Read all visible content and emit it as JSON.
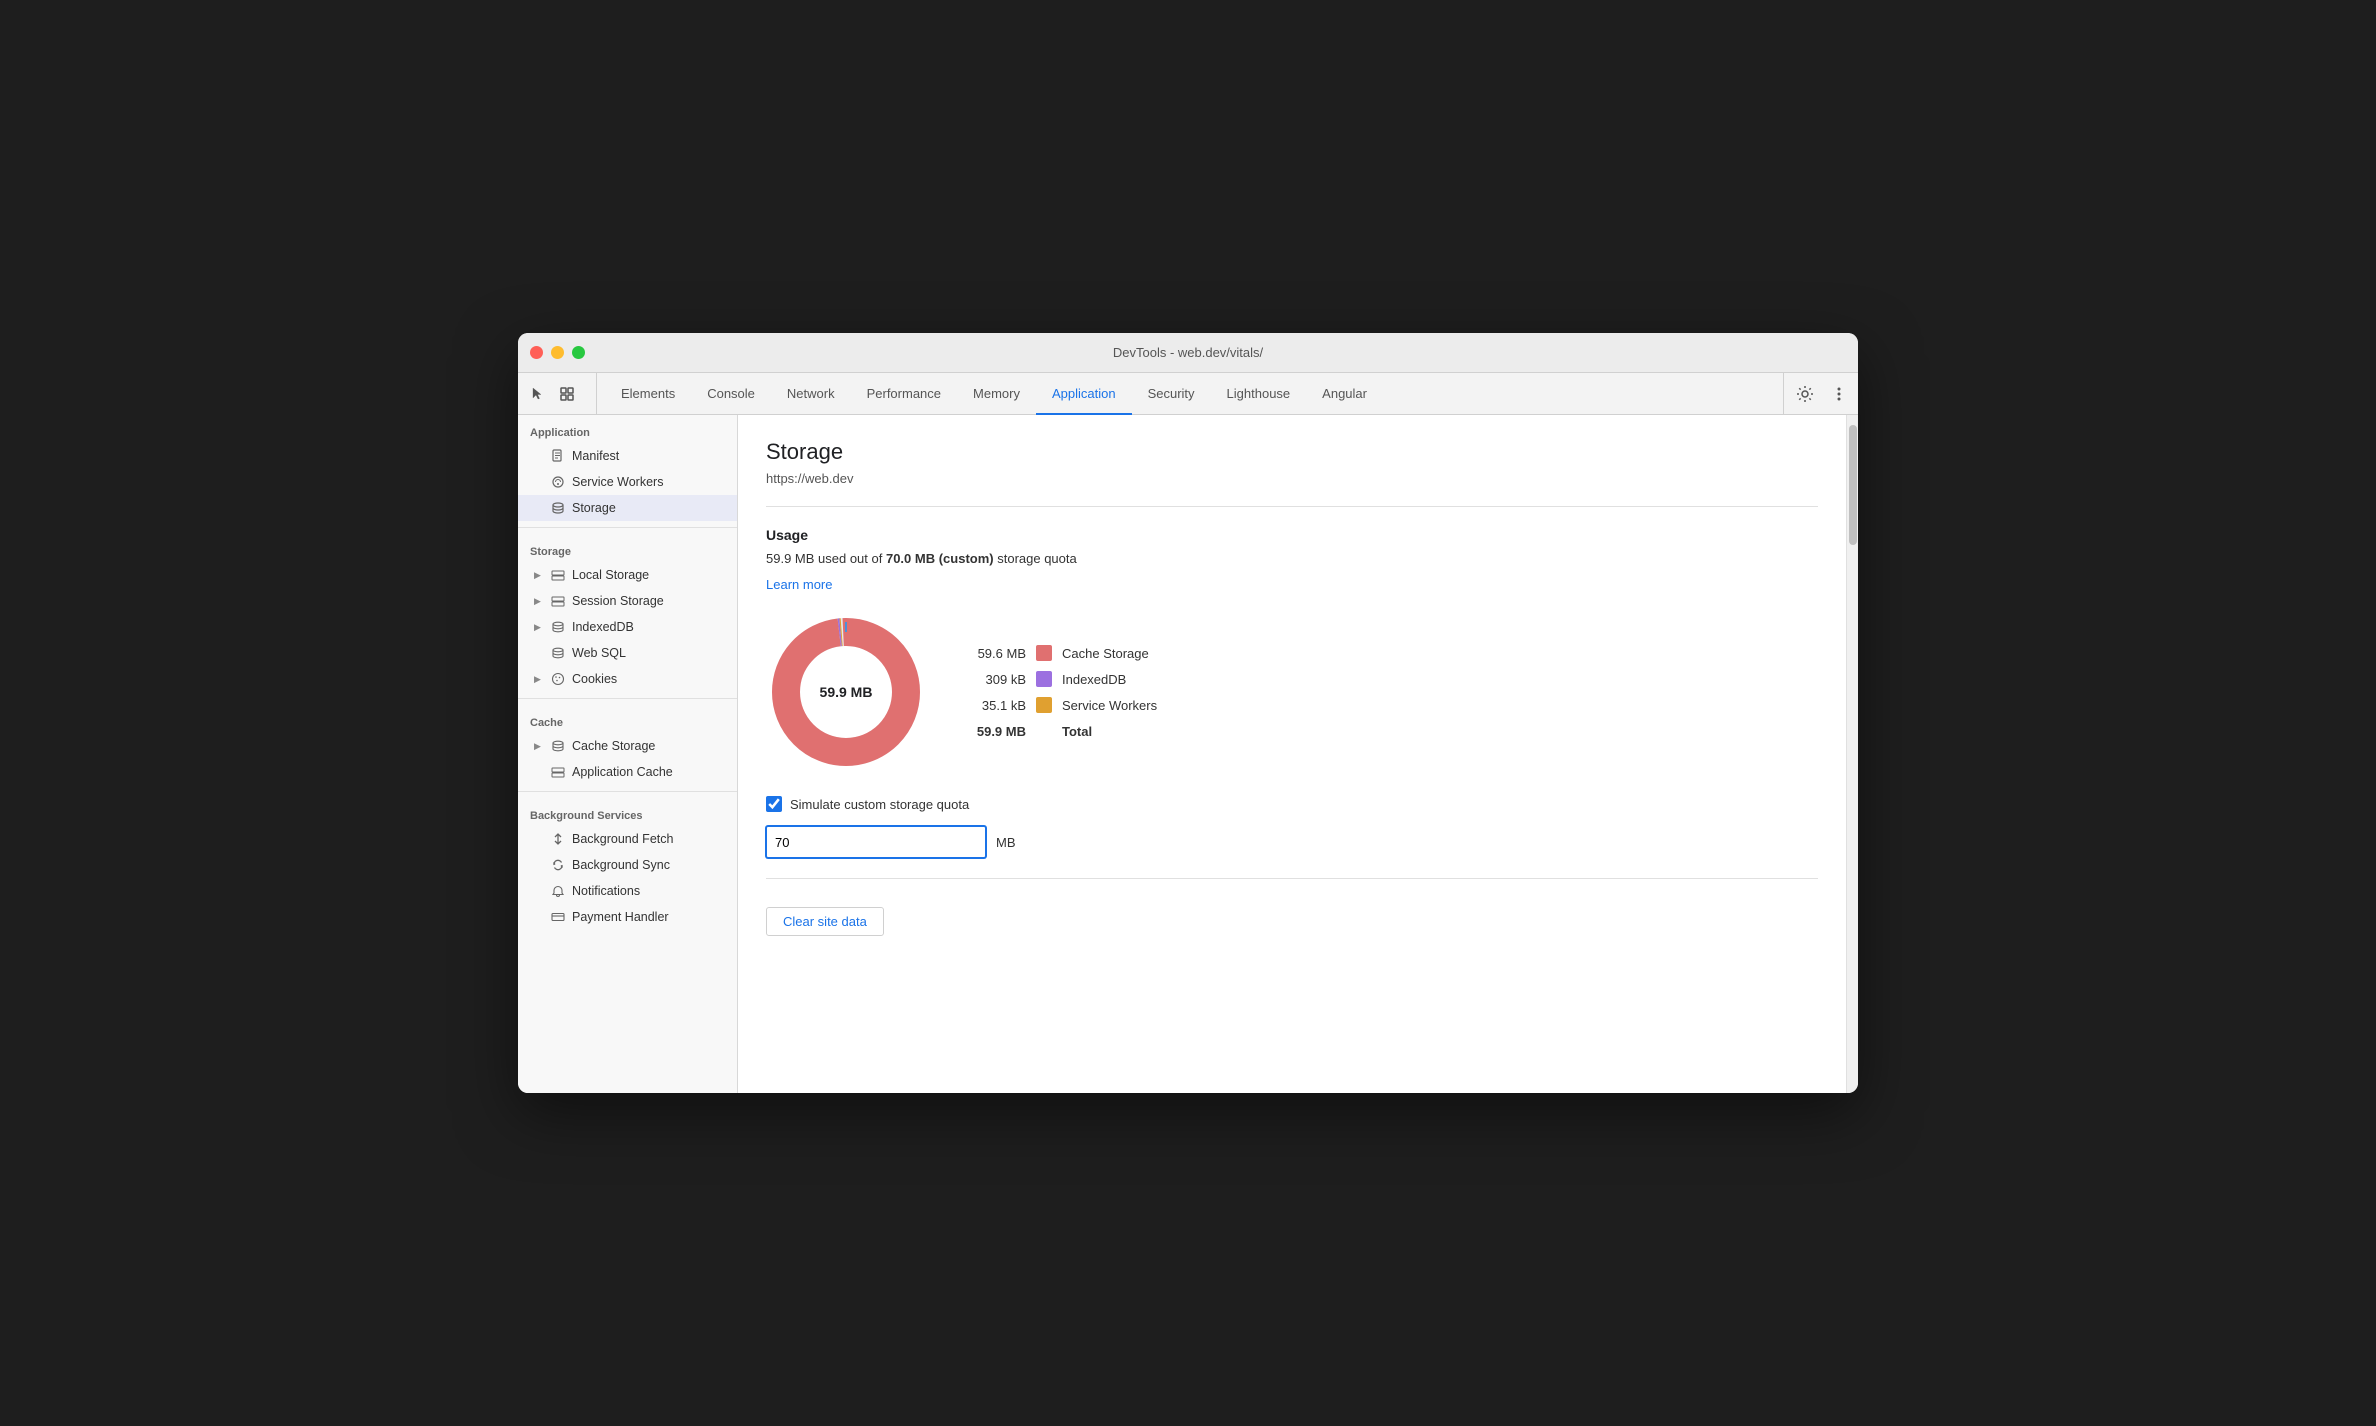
{
  "window": {
    "title": "DevTools - web.dev/vitals/"
  },
  "tabs": [
    {
      "id": "elements",
      "label": "Elements",
      "active": false
    },
    {
      "id": "console",
      "label": "Console",
      "active": false
    },
    {
      "id": "network",
      "label": "Network",
      "active": false
    },
    {
      "id": "performance",
      "label": "Performance",
      "active": false
    },
    {
      "id": "memory",
      "label": "Memory",
      "active": false
    },
    {
      "id": "application",
      "label": "Application",
      "active": true
    },
    {
      "id": "security",
      "label": "Security",
      "active": false
    },
    {
      "id": "lighthouse",
      "label": "Lighthouse",
      "active": false
    },
    {
      "id": "angular",
      "label": "Angular",
      "active": false
    }
  ],
  "sidebar": {
    "sections": [
      {
        "id": "application",
        "header": "Application",
        "items": [
          {
            "id": "manifest",
            "label": "Manifest",
            "icon": "📄",
            "level": 1
          },
          {
            "id": "service-workers",
            "label": "Service Workers",
            "icon": "⚙",
            "level": 1
          },
          {
            "id": "storage",
            "label": "Storage",
            "icon": "💾",
            "level": 1,
            "active": true
          }
        ]
      },
      {
        "id": "storage",
        "header": "Storage",
        "items": [
          {
            "id": "local-storage",
            "label": "Local Storage",
            "icon": "▦",
            "level": 1,
            "expandable": true
          },
          {
            "id": "session-storage",
            "label": "Session Storage",
            "icon": "▦",
            "level": 1,
            "expandable": true
          },
          {
            "id": "indexeddb",
            "label": "IndexedDB",
            "icon": "🗄",
            "level": 1,
            "expandable": true
          },
          {
            "id": "web-sql",
            "label": "Web SQL",
            "icon": "🗄",
            "level": 1
          },
          {
            "id": "cookies",
            "label": "Cookies",
            "icon": "🍪",
            "level": 1,
            "expandable": true
          }
        ]
      },
      {
        "id": "cache",
        "header": "Cache",
        "items": [
          {
            "id": "cache-storage",
            "label": "Cache Storage",
            "icon": "🗄",
            "level": 1,
            "expandable": true
          },
          {
            "id": "application-cache",
            "label": "Application Cache",
            "icon": "▦",
            "level": 1
          }
        ]
      },
      {
        "id": "background-services",
        "header": "Background Services",
        "items": [
          {
            "id": "background-fetch",
            "label": "Background Fetch",
            "icon": "↕",
            "level": 1
          },
          {
            "id": "background-sync",
            "label": "Background Sync",
            "icon": "↻",
            "level": 1
          },
          {
            "id": "notifications",
            "label": "Notifications",
            "icon": "🔔",
            "level": 1
          },
          {
            "id": "payment-handler",
            "label": "Payment Handler",
            "icon": "💳",
            "level": 1
          }
        ]
      }
    ]
  },
  "panel": {
    "title": "Storage",
    "url": "https://web.dev",
    "usage": {
      "section_title": "Usage",
      "description_prefix": "59.9 MB used out of ",
      "quota_bold": "70.0 MB (custom)",
      "description_suffix": " storage quota",
      "learn_more": "Learn more"
    },
    "chart": {
      "center_label": "59.9 MB",
      "segments": [
        {
          "id": "cache-storage",
          "value": 59.6,
          "percent": 99.5,
          "color": "#e07070",
          "label": "Cache Storage",
          "display": "59.6 MB"
        },
        {
          "id": "indexeddb",
          "value": 0.309,
          "percent": 0.3,
          "color": "#9c70e0",
          "label": "IndexedDB",
          "display": "309 kB"
        },
        {
          "id": "service-workers",
          "value": 0.035,
          "percent": 0.02,
          "color": "#e0a030",
          "label": "Service Workers",
          "display": "35.1 kB"
        }
      ],
      "total": {
        "label": "Total",
        "display": "59.9 MB"
      }
    },
    "simulate_quota": {
      "checkbox_label": "Simulate custom storage quota",
      "checked": true,
      "quota_value": "70",
      "quota_unit": "MB"
    },
    "clear_button": "Clear site data"
  }
}
